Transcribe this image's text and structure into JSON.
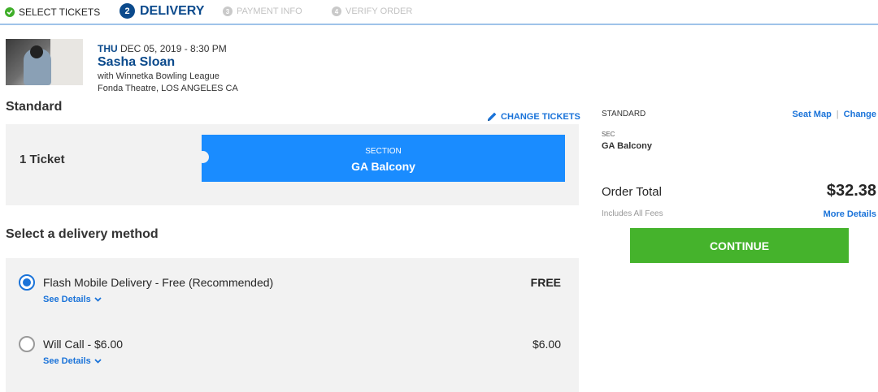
{
  "stepper": {
    "steps": [
      {
        "number": "",
        "label": "SELECT TICKETS",
        "state": "complete"
      },
      {
        "number": "2",
        "label": "DELIVERY",
        "state": "active"
      },
      {
        "number": "3",
        "label": "PAYMENT INFO",
        "state": "upcoming"
      },
      {
        "number": "4",
        "label": "VERIFY ORDER",
        "state": "upcoming"
      }
    ]
  },
  "event": {
    "day": "THU",
    "datetime": "DEC 05, 2019 - 8:30 PM",
    "title": "Sasha Sloan",
    "support": "with Winnetka Bowling League",
    "venue": "Fonda Theatre, LOS ANGELES CA"
  },
  "tickets": {
    "type": "Standard",
    "change_label": "CHANGE TICKETS",
    "count_label": "1 Ticket",
    "section_label": "SECTION",
    "section_value": "GA Balcony"
  },
  "delivery": {
    "heading": "Select a delivery method",
    "options": [
      {
        "label": "Flash Mobile Delivery - Free (Recommended)",
        "price": "FREE",
        "details_label": "See Details",
        "selected": true
      },
      {
        "label": "Will Call - $6.00",
        "price": "$6.00",
        "details_label": "See Details",
        "selected": false
      }
    ]
  },
  "summary": {
    "ticket_type": "STANDARD",
    "seat_map_label": "Seat Map",
    "separator": "|",
    "change_label": "Change",
    "sec_label": "SEC",
    "sec_value": "GA Balcony",
    "order_total_label": "Order Total",
    "order_total_value": "$32.38",
    "fees_note": "Includes All Fees",
    "more_details_label": "More Details",
    "continue_label": "CONTINUE"
  },
  "colors": {
    "brand_blue": "#0b4a8c",
    "link_blue": "#1a73d9",
    "section_blue": "#1a8cff",
    "continue_green": "#45b32c",
    "complete_green": "#3fae29"
  }
}
